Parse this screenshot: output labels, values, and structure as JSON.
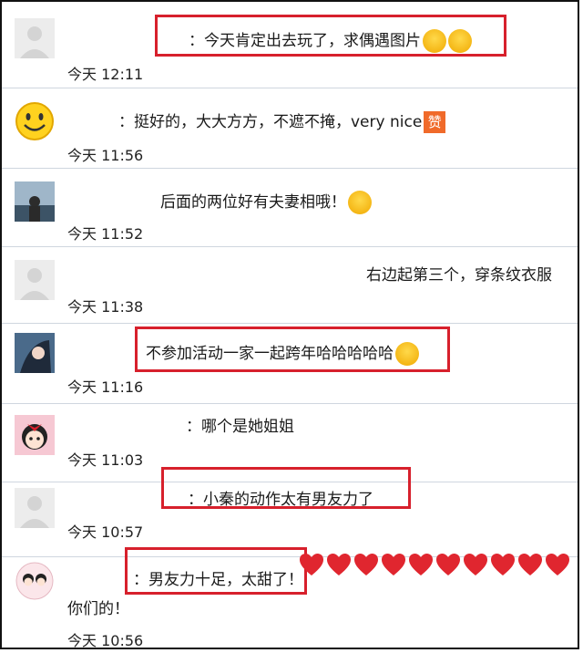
{
  "comments": [
    {
      "username": "",
      "text": "：今天肯定出去玩了，求偶遇图片",
      "time": "今天 12:11",
      "avatar": "default-avatar"
    },
    {
      "username": "",
      "text": "：挺好的，大大方方，不遮不掩，very nice",
      "time": "今天 11:56",
      "avatar": "smiley-avatar"
    },
    {
      "username": "",
      "text": "后面的两位好有夫妻相哦！",
      "time": "今天 11:52",
      "avatar": "photo-avatar"
    },
    {
      "username": "",
      "text": "右边起第三个，穿条纹衣服",
      "time": "今天 11:38",
      "avatar": "default-avatar"
    },
    {
      "username": "",
      "text": "不参加活动一家一起跨年哈哈哈哈哈",
      "time": "今天 11:16",
      "avatar": "anime-avatar"
    },
    {
      "username": "",
      "text": "：哪个是她姐姐",
      "time": "今天 11:03",
      "avatar": "cartoon-girl-avatar"
    },
    {
      "username": "",
      "text": "：小秦的动作太有男友力了",
      "time": "今天 10:57",
      "avatar": "default-avatar"
    },
    {
      "username": "",
      "text": "：男友力十足，太甜了！",
      "text2": "你们的！",
      "time": "今天 10:56",
      "avatar": "couple-avatar"
    }
  ],
  "emoji_names": [
    "laughing-tears-icon",
    "zan-icon",
    "grin-icon",
    "giggle-icon",
    "heart-icon"
  ],
  "colors": {
    "highlight": "#d7202c",
    "divider": "#cfd6df",
    "heart": "#e0262f"
  }
}
